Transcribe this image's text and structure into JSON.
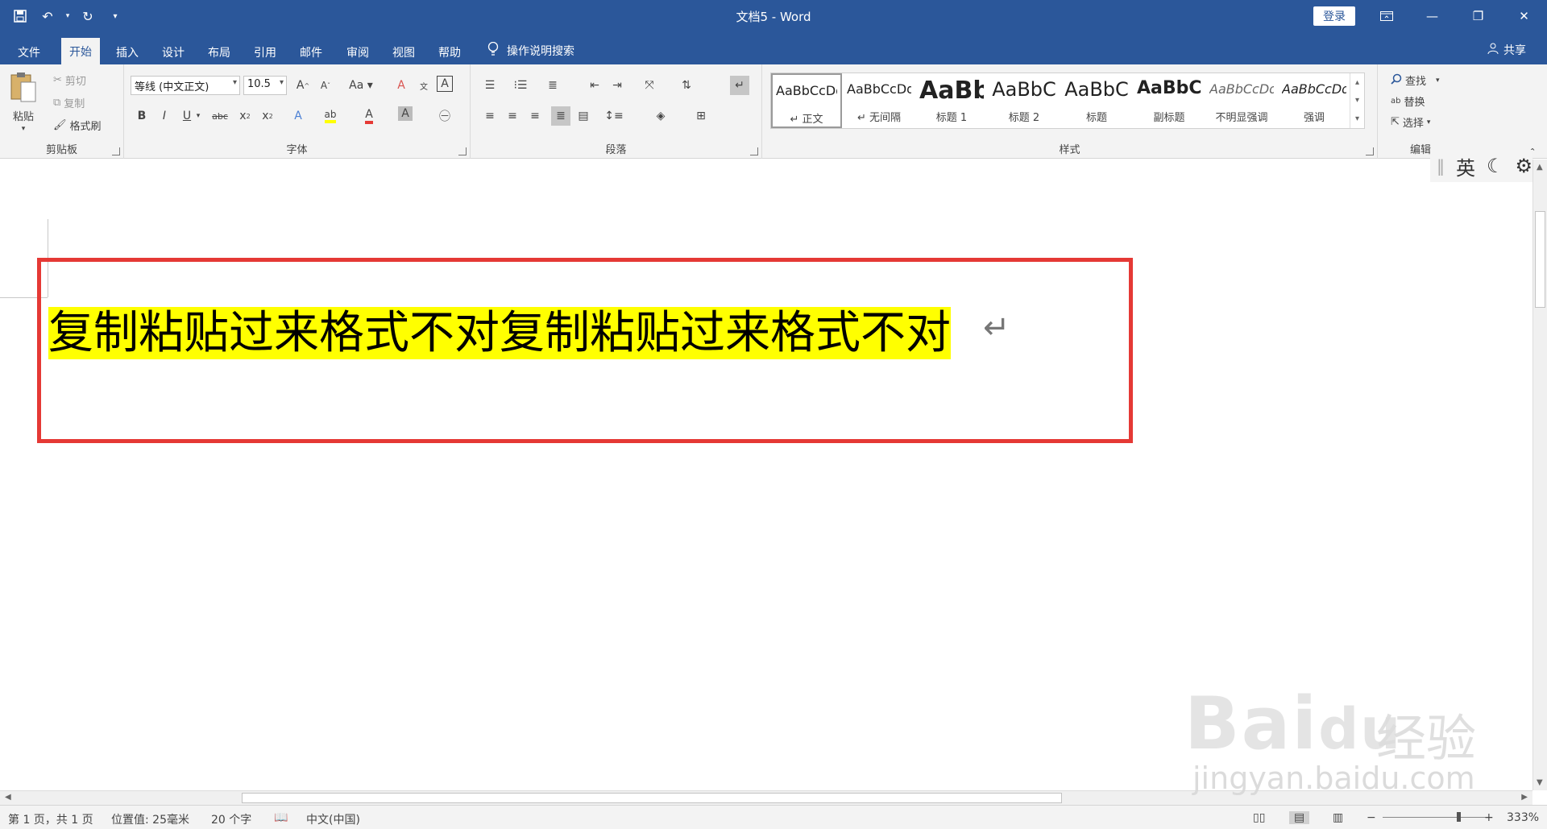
{
  "window": {
    "title": "文档5  -  Word",
    "login_label": "登录",
    "buttons": [
      "ribbon-display-icon",
      "minimize-icon",
      "restore-icon",
      "close-icon"
    ]
  },
  "quick_access": [
    "save-icon",
    "undo-icon",
    "redo-icon",
    "customize-icon"
  ],
  "tabs": [
    {
      "label": "文件",
      "active": false
    },
    {
      "label": "开始",
      "active": true
    },
    {
      "label": "插入",
      "active": false
    },
    {
      "label": "设计",
      "active": false
    },
    {
      "label": "布局",
      "active": false
    },
    {
      "label": "引用",
      "active": false
    },
    {
      "label": "邮件",
      "active": false
    },
    {
      "label": "审阅",
      "active": false
    },
    {
      "label": "视图",
      "active": false
    },
    {
      "label": "帮助",
      "active": false
    }
  ],
  "tell_me": "操作说明搜索",
  "share": "共享",
  "clipboard": {
    "label": "剪贴板",
    "paste": "粘贴",
    "cut": "剪切",
    "copy": "复制",
    "format_painter": "格式刷"
  },
  "font": {
    "label": "字体",
    "font_name": "等线 (中文正文)",
    "font_size": "10.5"
  },
  "paragraph": {
    "label": "段落"
  },
  "styles": {
    "label": "样式",
    "items": [
      {
        "preview": "AaBbCcDd",
        "name": "↵ 正文",
        "selected": true
      },
      {
        "preview": "AaBbCcDd",
        "name": "↵ 无间隔",
        "selected": false
      },
      {
        "preview": "AaBb",
        "name": "标题 1",
        "selected": false
      },
      {
        "preview": "AaBbC",
        "name": "标题 2",
        "selected": false
      },
      {
        "preview": "AaBbC",
        "name": "标题",
        "selected": false
      },
      {
        "preview": "AaBbC",
        "name": "副标题",
        "selected": false
      },
      {
        "preview": "AaBbCcDd",
        "name": "不明显强调",
        "selected": false
      },
      {
        "preview": "AaBbCcDd",
        "name": "强调",
        "selected": false
      }
    ]
  },
  "editing": {
    "label": "编辑",
    "find": "查找",
    "replace": "替换",
    "select": "选择"
  },
  "document": {
    "text": "复制粘贴过来格式不对复制粘贴过来格式不对",
    "highlight_color": "#ffff00",
    "annotation_color": "#e53935"
  },
  "ime": {
    "mode": "英"
  },
  "status": {
    "page": "第 1 页，共 1 页",
    "position": "位置值: 25毫米",
    "words": "20 个字",
    "language": "中文(中国)",
    "zoom": "333%"
  },
  "watermark": {
    "logo": "Bai",
    "logo2": "du",
    "cn": "经验",
    "url": "jingyan.baidu.com"
  },
  "colors": {
    "brand": "#2b579a",
    "ribbon": "#f3f3f3"
  }
}
